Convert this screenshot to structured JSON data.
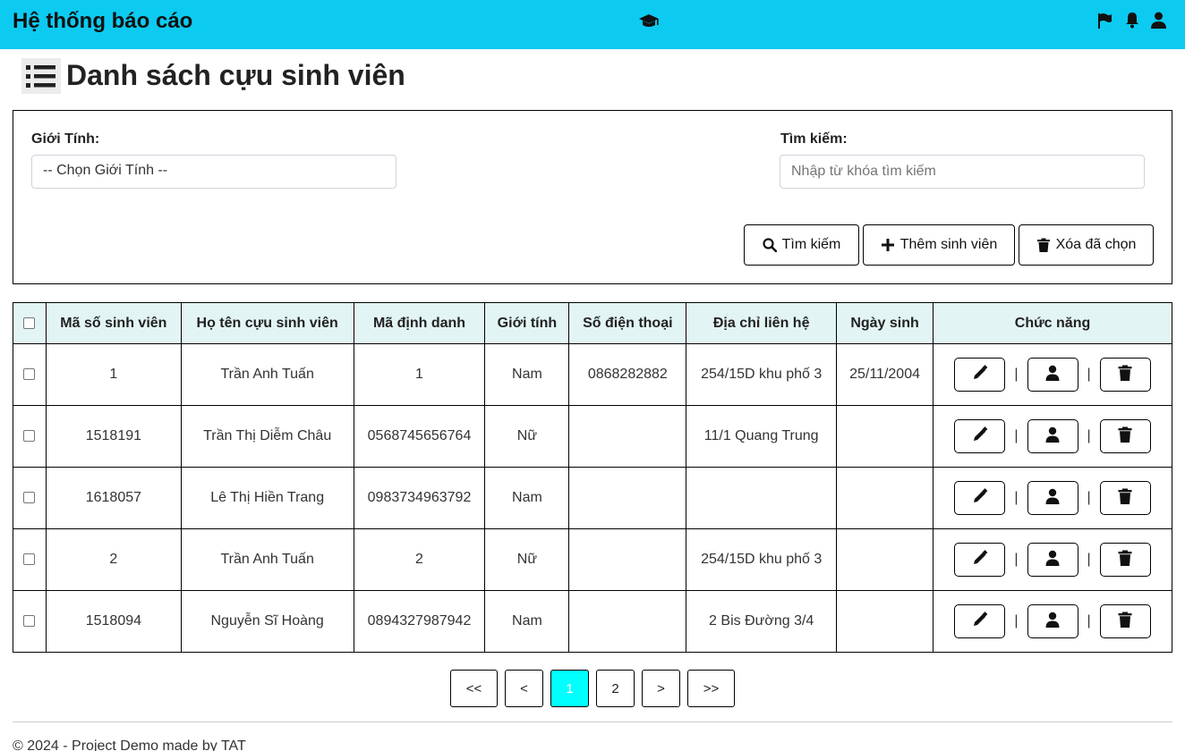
{
  "header": {
    "brand": "Hệ thống báo cáo",
    "center_icon": "graduation-cap-icon",
    "right_icons": [
      "flag-icon",
      "bell-icon",
      "user-icon"
    ],
    "bg_color": "#0dcaf0"
  },
  "page": {
    "title_icon": "list-icon",
    "title": "Danh sách cựu sinh viên"
  },
  "filters": {
    "gender_label": "Giới Tính:",
    "gender_selected": "-- Chọn Giới Tính --",
    "search_label": "Tìm kiếm:",
    "search_placeholder": "Nhập từ khóa tìm kiếm",
    "search_value": ""
  },
  "buttons": {
    "search": "Tìm kiếm",
    "add": "Thêm sinh viên",
    "delete_selected": "Xóa đã chọn"
  },
  "table": {
    "columns": [
      "Mã số sinh viên",
      "Họ tên cựu sinh viên",
      "Mã định danh",
      "Giới tính",
      "Số điện thoại",
      "Địa chỉ liên hệ",
      "Ngày sinh",
      "Chức năng"
    ],
    "action_separator": "|",
    "rows": [
      {
        "id": "1",
        "name": "Trần Anh Tuấn",
        "ident": "1",
        "gender": "Nam",
        "phone": "0868282882",
        "address": "254/15D khu phố 3",
        "dob": "25/11/2004"
      },
      {
        "id": "1518191",
        "name": "Trần Thị Diễm Châu",
        "ident": "0568745656764",
        "gender": "Nữ",
        "phone": "",
        "address": "11/1 Quang Trung",
        "dob": ""
      },
      {
        "id": "1618057",
        "name": "Lê Thị Hiền Trang",
        "ident": "0983734963792",
        "gender": "Nam",
        "phone": "",
        "address": "",
        "dob": ""
      },
      {
        "id": "2",
        "name": "Trần Anh Tuấn",
        "ident": "2",
        "gender": "Nữ",
        "phone": "",
        "address": "254/15D khu phố 3",
        "dob": ""
      },
      {
        "id": "1518094",
        "name": "Nguyễn Sĩ Hoàng",
        "ident": "0894327987942",
        "gender": "Nam",
        "phone": "",
        "address": "2 Bis Đường 3/4",
        "dob": ""
      }
    ]
  },
  "pagination": {
    "first": "<<",
    "prev": "<",
    "pages": [
      "1",
      "2"
    ],
    "current_page": "1",
    "next": ">",
    "last": ">>",
    "active_color": "#00ffff"
  },
  "footer": {
    "text": "© 2024 - Project Demo made by TAT"
  }
}
